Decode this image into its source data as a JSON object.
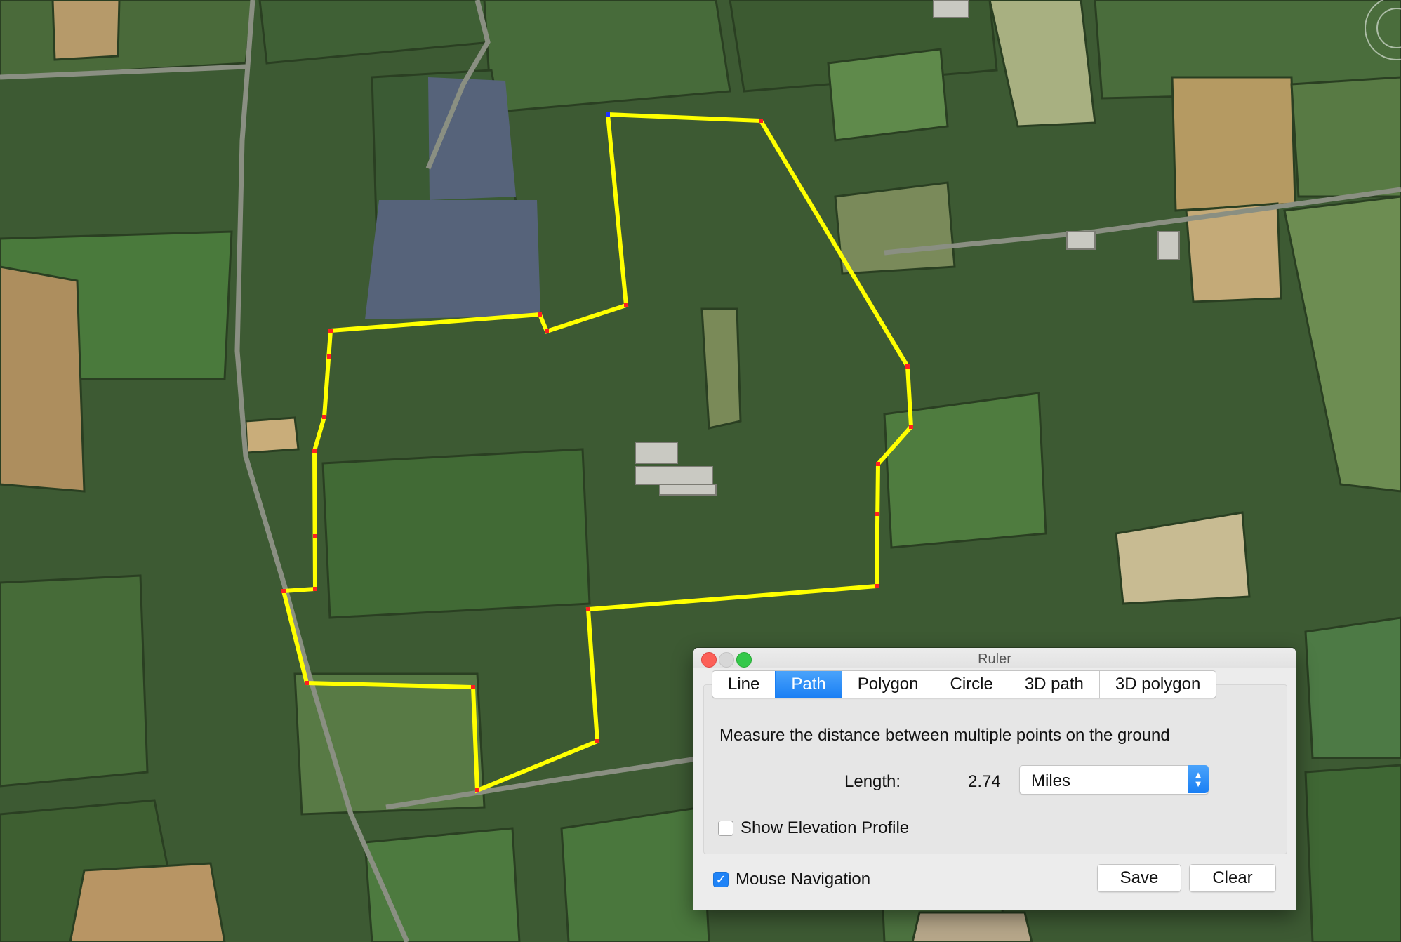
{
  "map": {
    "path_color": "#ffff00",
    "vertex_color": "#ff2020",
    "start_vertex_color": "#2030ff",
    "imagery": "satellite-farmland"
  },
  "ruler": {
    "title": "Ruler",
    "tabs": [
      {
        "label": "Line",
        "selected": false
      },
      {
        "label": "Path",
        "selected": true
      },
      {
        "label": "Polygon",
        "selected": false
      },
      {
        "label": "Circle",
        "selected": false
      },
      {
        "label": "3D path",
        "selected": false
      },
      {
        "label": "3D polygon",
        "selected": false
      }
    ],
    "description": "Measure the distance between multiple points on the ground",
    "length_label": "Length:",
    "length_value": "2.74",
    "unit": "Miles",
    "show_elevation_label": "Show Elevation Profile",
    "show_elevation_checked": false,
    "mouse_navigation_label": "Mouse Navigation",
    "mouse_navigation_checked": true,
    "save_label": "Save",
    "clear_label": "Clear",
    "accent_color": "#1f83f7"
  }
}
